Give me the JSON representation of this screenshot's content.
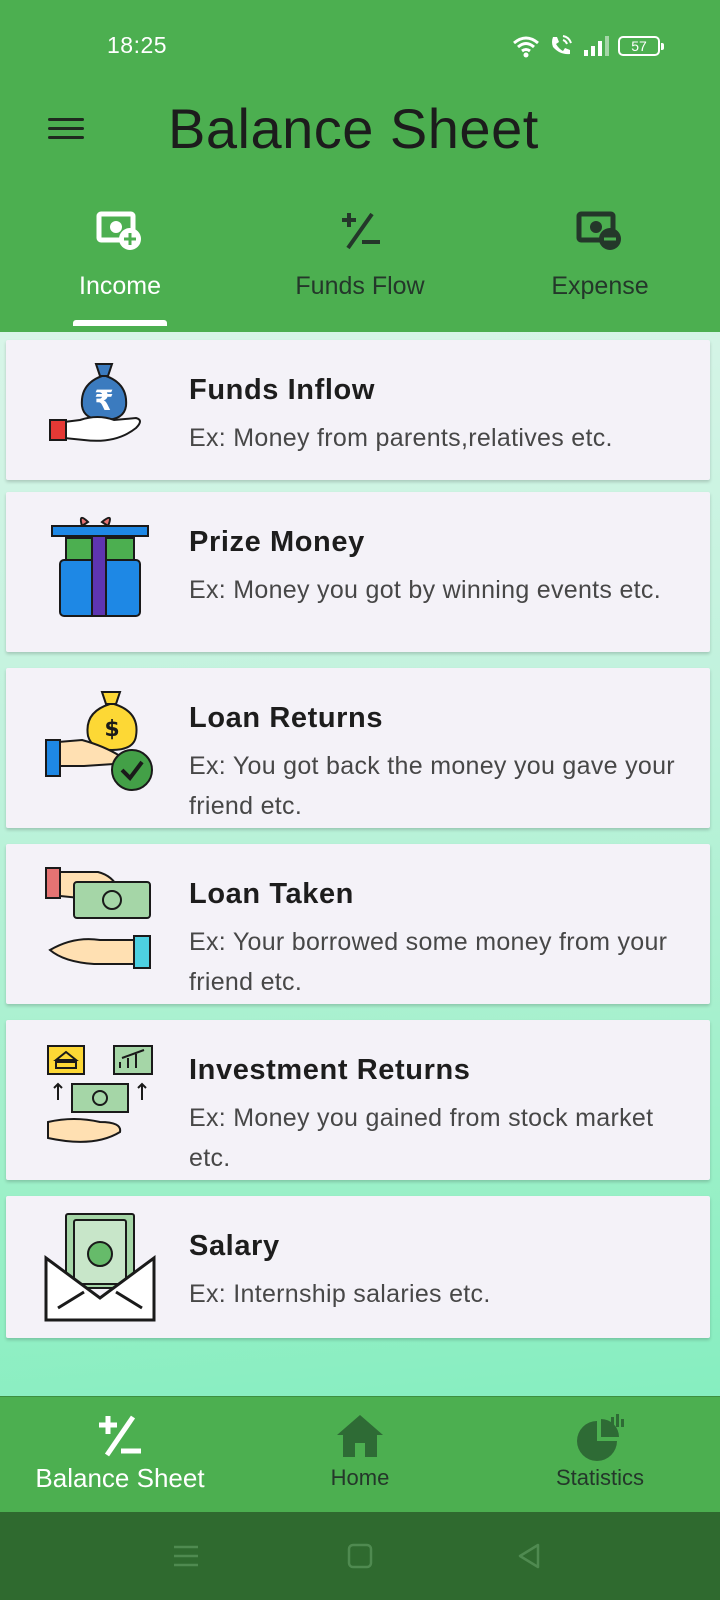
{
  "status_bar": {
    "time": "18:25",
    "battery": "57",
    "icons": [
      "wifi-icon",
      "wifi-call-icon",
      "signal-icon",
      "battery-icon"
    ]
  },
  "header": {
    "title": "Balance Sheet",
    "menu_icon": "hamburger-menu-icon",
    "background_color": "#4caf50"
  },
  "tabs": [
    {
      "label": "Income",
      "icon": "income-money-plus-icon",
      "active": true
    },
    {
      "label": "Funds Flow",
      "icon": "plus-minus-icon",
      "active": false
    },
    {
      "label": "Expense",
      "icon": "expense-money-minus-icon",
      "active": false
    }
  ],
  "categories": [
    {
      "title": "Funds Inflow",
      "description": "Ex: Money from parents,relatives etc.",
      "icon": "rupee-bag-hand-icon"
    },
    {
      "title": "Prize Money",
      "description": "Ex: Money you got by winning events etc.",
      "icon": "gift-box-icon"
    },
    {
      "title": "Loan Returns",
      "description": "Ex: You got back the money you gave your friend etc.",
      "icon": "money-bag-check-icon"
    },
    {
      "title": "Loan Taken",
      "description": "Ex: Your borrowed some money from your friend etc.",
      "icon": "cash-handover-icon"
    },
    {
      "title": "Investment Returns",
      "description": "Ex: Money you gained from stock market etc.",
      "icon": "investment-bank-chart-icon"
    },
    {
      "title": "Salary",
      "description": "Ex: Internship salaries etc.",
      "icon": "salary-envelope-icon"
    }
  ],
  "bottom_nav": [
    {
      "label": "Balance Sheet",
      "icon": "plus-minus-icon",
      "active": true
    },
    {
      "label": "Home",
      "icon": "home-icon",
      "active": false
    },
    {
      "label": "Statistics",
      "icon": "pie-chart-icon",
      "active": false
    }
  ],
  "system_nav": [
    "recents-icon",
    "home-square-icon",
    "back-triangle-icon"
  ]
}
